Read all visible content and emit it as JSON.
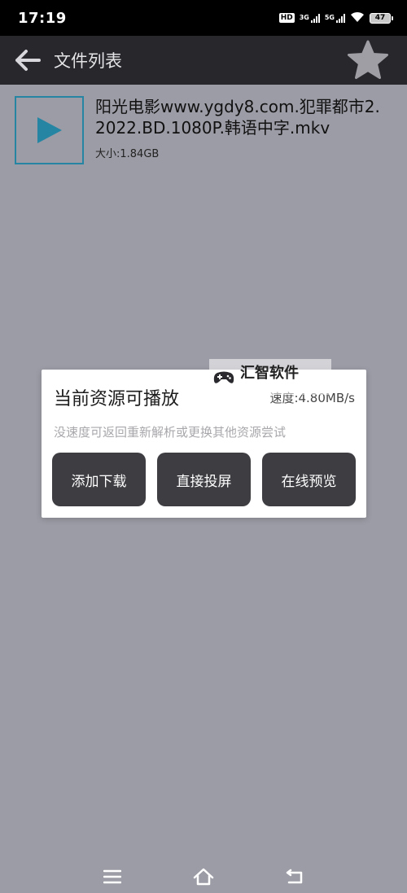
{
  "status_bar": {
    "time": "17:19",
    "hd_label": "HD",
    "net1_label": "3G",
    "net2_label": "5G",
    "battery": "47"
  },
  "app_bar": {
    "title": "文件列表",
    "back_icon": "arrow-left-icon",
    "favorite_icon": "star-icon"
  },
  "files": [
    {
      "name": "阳光电影www.ygdy8.com.犯罪都市2.2022.BD.1080P.韩语中字.mkv",
      "size": "大小:1.84GB",
      "icon": "play-icon"
    }
  ],
  "dialog": {
    "title": "当前资源可播放",
    "speed": "速度:4.80MB/s",
    "hint": "没速度可返回重新解析或更换其他资源尝试",
    "buttons": {
      "download": "添加下载",
      "cast": "直接投屏",
      "preview": "在线预览"
    }
  },
  "watermark": {
    "text": "汇智软件",
    "icon": "gamepad-icon"
  },
  "nav_bar": {
    "menu_icon": "menu-icon",
    "home_icon": "home-icon",
    "back_icon": "back-icon"
  },
  "colors": {
    "accent": "#2785a4",
    "app_bar": "#28272c",
    "overlay_bg": "#9c9ca6",
    "button_bg": "#3e3d42"
  }
}
